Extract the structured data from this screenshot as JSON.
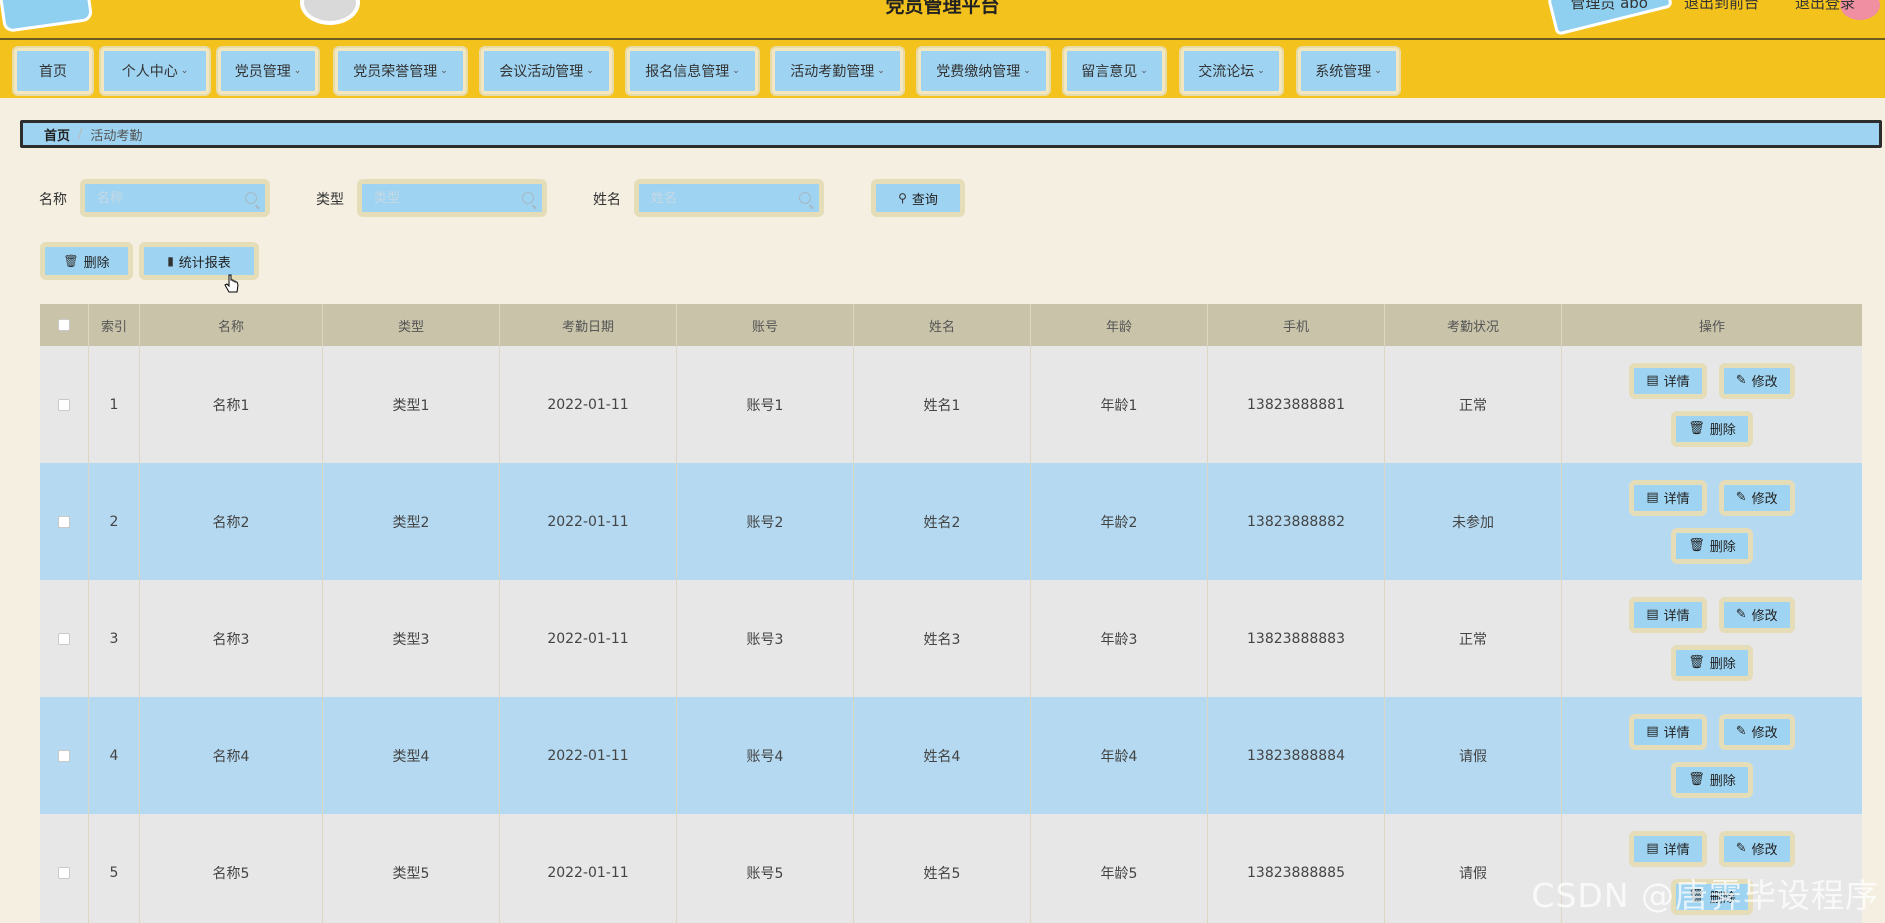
{
  "header": {
    "title": "党员管理平台",
    "links": [
      "管理员 abo",
      "退出到前台",
      "退出登录"
    ]
  },
  "nav": [
    {
      "label": "首页",
      "dropdown": false
    },
    {
      "label": "个人中心",
      "dropdown": true
    },
    {
      "label": "党员管理",
      "dropdown": true
    },
    {
      "label": "党员荣誉管理",
      "dropdown": true
    },
    {
      "label": "会议活动管理",
      "dropdown": true
    },
    {
      "label": "报名信息管理",
      "dropdown": true
    },
    {
      "label": "活动考勤管理",
      "dropdown": true
    },
    {
      "label": "党费缴纳管理",
      "dropdown": true
    },
    {
      "label": "留言意见",
      "dropdown": true
    },
    {
      "label": "交流论坛",
      "dropdown": true
    },
    {
      "label": "系统管理",
      "dropdown": true
    }
  ],
  "breadcrumb": {
    "home": "首页",
    "separator": "/",
    "current": "活动考勤"
  },
  "search": {
    "fields": [
      {
        "label": "名称",
        "placeholder": "名称"
      },
      {
        "label": "类型",
        "placeholder": "类型"
      },
      {
        "label": "姓名",
        "placeholder": "姓名"
      }
    ],
    "query_label": "查询"
  },
  "actions": {
    "delete_label": "删除",
    "report_label": "统计报表"
  },
  "table": {
    "headers": [
      "索引",
      "名称",
      "类型",
      "考勤日期",
      "账号",
      "姓名",
      "年龄",
      "手机",
      "考勤状况",
      "操作"
    ],
    "rows": [
      {
        "index": "1",
        "name": "名称1",
        "type": "类型1",
        "date": "2022-01-11",
        "account": "账号1",
        "person": "姓名1",
        "age": "年龄1",
        "phone": "13823888881",
        "status": "正常"
      },
      {
        "index": "2",
        "name": "名称2",
        "type": "类型2",
        "date": "2022-01-11",
        "account": "账号2",
        "person": "姓名2",
        "age": "年龄2",
        "phone": "13823888882",
        "status": "未参加"
      },
      {
        "index": "3",
        "name": "名称3",
        "type": "类型3",
        "date": "2022-01-11",
        "account": "账号3",
        "person": "姓名3",
        "age": "年龄3",
        "phone": "13823888883",
        "status": "正常"
      },
      {
        "index": "4",
        "name": "名称4",
        "type": "类型4",
        "date": "2022-01-11",
        "account": "账号4",
        "person": "姓名4",
        "age": "年龄4",
        "phone": "13823888884",
        "status": "请假"
      },
      {
        "index": "5",
        "name": "名称5",
        "type": "类型5",
        "date": "2022-01-11",
        "account": "账号5",
        "person": "姓名5",
        "age": "年龄5",
        "phone": "13823888885",
        "status": "请假"
      }
    ],
    "row_actions": {
      "detail": "详情",
      "edit": "修改",
      "delete": "删除"
    }
  },
  "watermark": "CSDN @唐霁毕设程序",
  "colors": {
    "header_bg": "#f3c21c",
    "button_bg": "#9ed3f1",
    "row_alt": "#b4d9f1",
    "table_head": "#c8c3a9",
    "page_bg": "#f4efe1"
  }
}
